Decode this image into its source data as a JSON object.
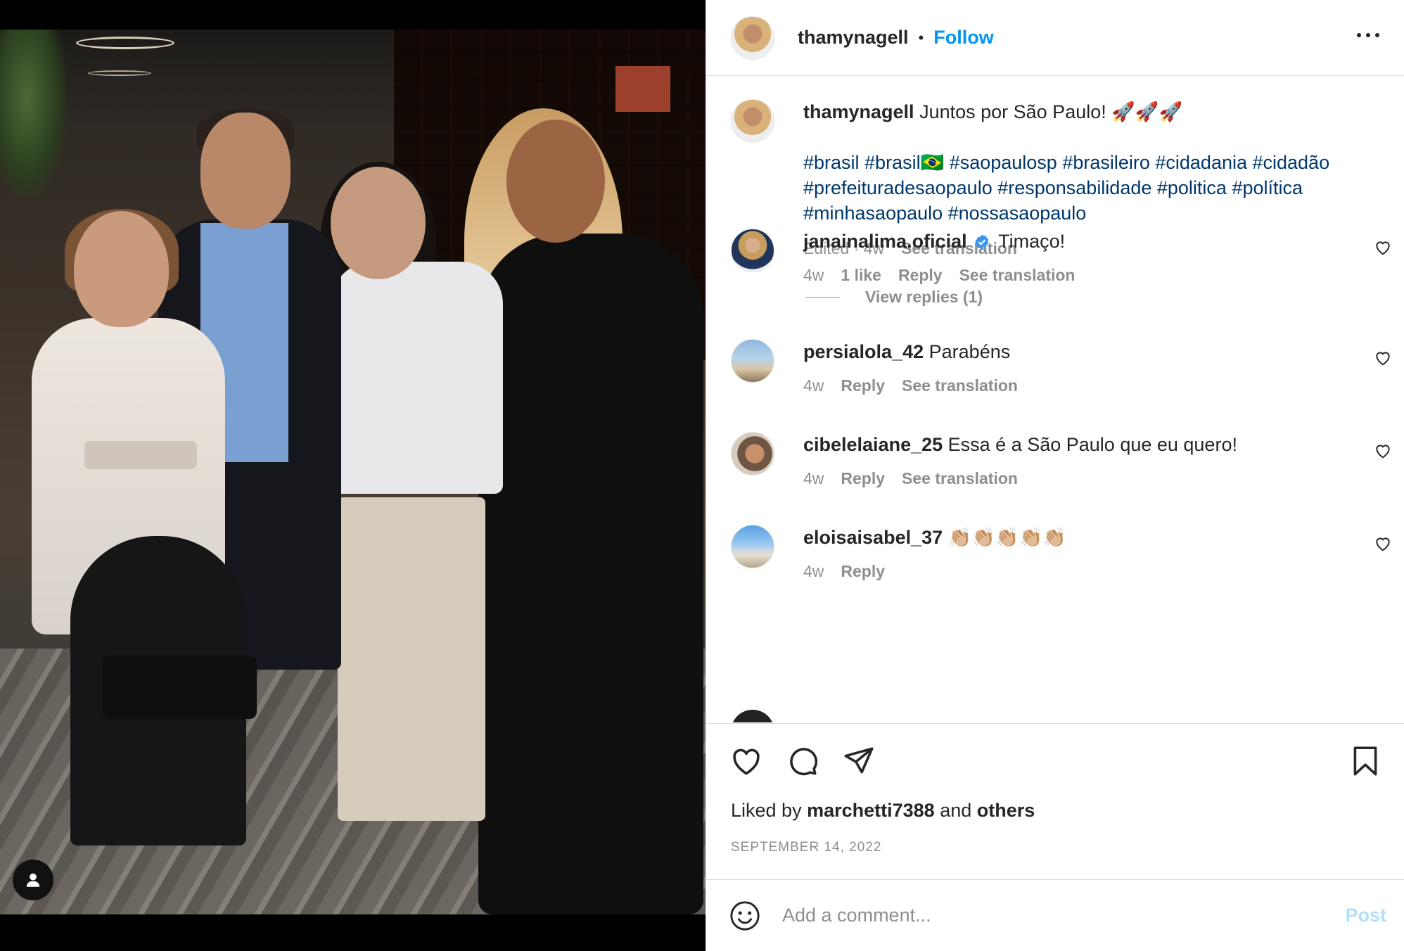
{
  "post": {
    "username": "thamynagell",
    "follow_label": "Follow",
    "separator": "•"
  },
  "caption": {
    "username": "thamynagell",
    "text": "Juntos por São Paulo! 🚀🚀🚀",
    "hashtags_line1": "#brasil #brasil🇧🇷 #saopaulosp #brasileiro #cidadania #cidadão",
    "hashtags_line2": "#prefeituradesaopaulo #responsabilidade #politica #política",
    "hashtags_line3": "#minhasaopaulo #nossasaopaulo",
    "meta": "Edited · 4w",
    "see_translation": "See translation"
  },
  "comments": [
    {
      "username": "janainalima.oficial",
      "verified": true,
      "text": "Timaço!",
      "time": "4w",
      "likes": "1 like",
      "reply": "Reply",
      "translate": "See translation"
    },
    {
      "username": "persialola_42",
      "text": "Parabéns",
      "time": "4w",
      "reply": "Reply",
      "translate": "See translation"
    },
    {
      "username": "cibelelaiane_25",
      "text": "Essa é a São Paulo que eu quero!",
      "time": "4w",
      "reply": "Reply",
      "translate": "See translation"
    },
    {
      "username": "eloisaisabel_37",
      "text": "👏🏼👏🏼👏🏼👏🏼👏🏼",
      "time": "4w",
      "reply": "Reply"
    }
  ],
  "view_replies": "View replies (1)",
  "partial_comment": {
    "username": "..."
  },
  "likes": {
    "prefix": "Liked by",
    "user": "marchetti7388",
    "and": "and",
    "others": "others"
  },
  "date": "SEPTEMBER 14, 2022",
  "composer": {
    "placeholder": "Add a comment...",
    "post_label": "Post"
  },
  "colors": {
    "accent": "#0095f6",
    "hashtag": "#00376b",
    "muted": "#8e8e8e",
    "verified": "#3897f0",
    "post_disabled": "#b2dffc"
  },
  "icons": [
    "more-options-icon",
    "heart-icon",
    "comment-icon",
    "share-icon",
    "bookmark-icon",
    "emoji-icon",
    "verified-badge-icon",
    "user-tag-icon"
  ]
}
